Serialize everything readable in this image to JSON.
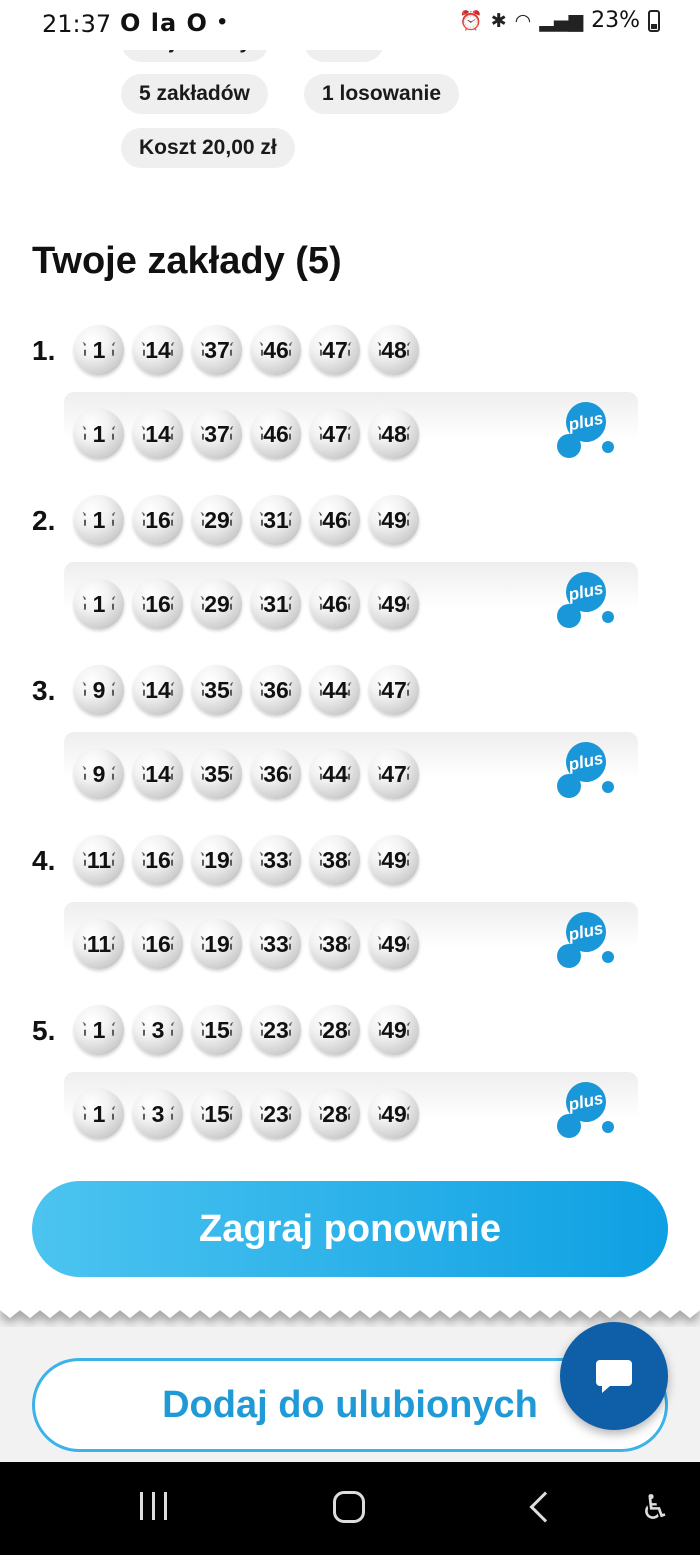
{
  "status_bar": {
    "time": "21:37",
    "left_icons": "O la O",
    "battery": "23%"
  },
  "top_chips": {
    "partial_1": "Moje liczby",
    "partial_2": "Plus",
    "bets_count": "5 zakładów",
    "draws": "1 losowanie",
    "cost": "Koszt 20,00 zł"
  },
  "section_title": "Twoje zakłady (5)",
  "bets": [
    {
      "index": "1.",
      "numbers": [
        "1",
        "14",
        "37",
        "46",
        "47",
        "48"
      ],
      "plus_numbers": [
        "1",
        "14",
        "37",
        "46",
        "47",
        "48"
      ]
    },
    {
      "index": "2.",
      "numbers": [
        "1",
        "16",
        "29",
        "31",
        "46",
        "49"
      ],
      "plus_numbers": [
        "1",
        "16",
        "29",
        "31",
        "46",
        "49"
      ]
    },
    {
      "index": "3.",
      "numbers": [
        "9",
        "14",
        "35",
        "36",
        "44",
        "47"
      ],
      "plus_numbers": [
        "9",
        "14",
        "35",
        "36",
        "44",
        "47"
      ]
    },
    {
      "index": "4.",
      "numbers": [
        "11",
        "16",
        "19",
        "33",
        "38",
        "49"
      ],
      "plus_numbers": [
        "11",
        "16",
        "19",
        "33",
        "38",
        "49"
      ]
    },
    {
      "index": "5.",
      "numbers": [
        "1",
        "3",
        "15",
        "23",
        "28",
        "49"
      ],
      "plus_numbers": [
        "1",
        "3",
        "15",
        "23",
        "28",
        "49"
      ]
    }
  ],
  "plus_logo_text": "plus",
  "buttons": {
    "play_again": "Zagraj ponownie",
    "add_favorite": "Dodaj do ulubionych"
  },
  "colors": {
    "accent": "#0ea0e3",
    "accent_light": "#4cc4f0",
    "chat_fab": "#0f5ea8",
    "chip_bg": "#efefef"
  }
}
